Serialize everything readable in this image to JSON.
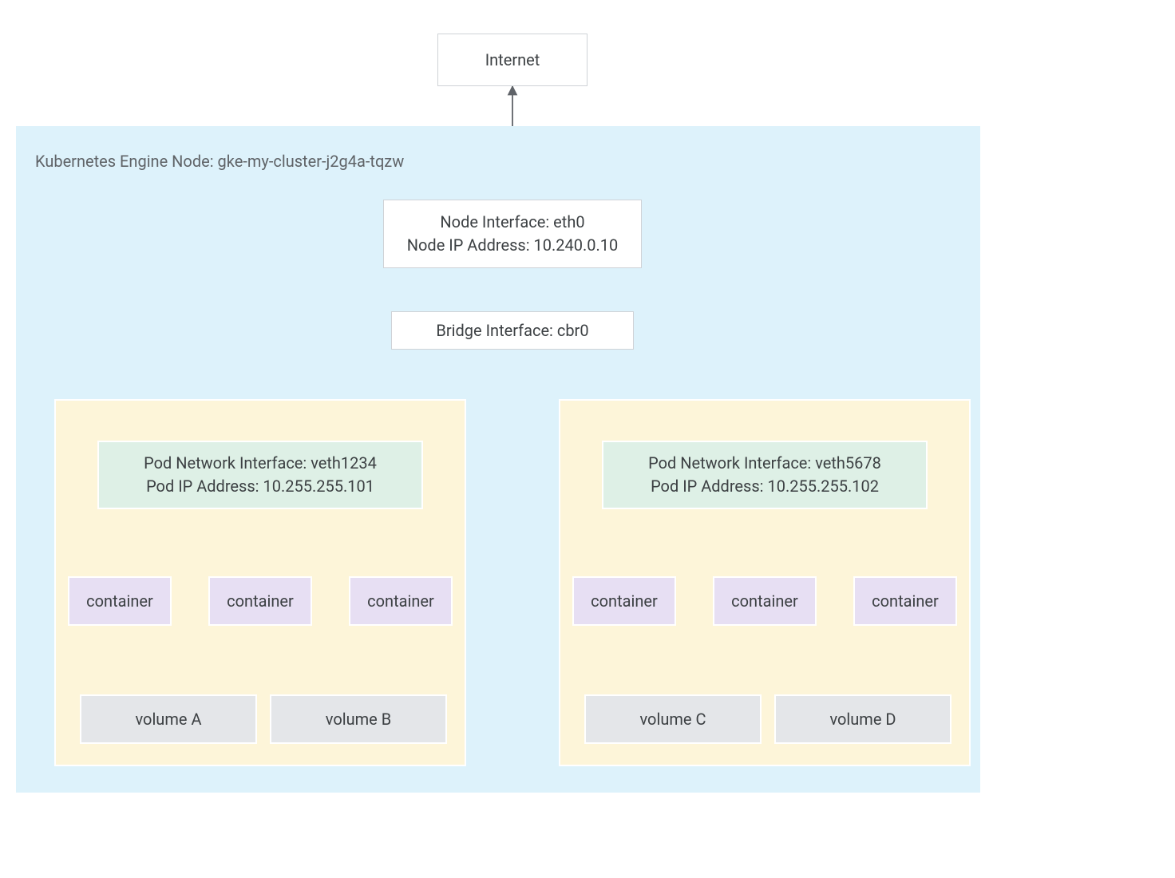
{
  "internet": "Internet",
  "node": {
    "title": "Kubernetes Engine Node: gke-my-cluster-j2g4a-tqzw",
    "iface_line1": "Node Interface: eth0",
    "iface_line2": "Node IP Address: 10.240.0.10"
  },
  "bridge": "Bridge Interface: cbr0",
  "pods": [
    {
      "iface_line1": "Pod Network Interface: veth1234",
      "iface_line2": "Pod IP Address: 10.255.255.101",
      "containers": [
        "container",
        "container",
        "container"
      ],
      "volumes": [
        "volume A",
        "volume B"
      ]
    },
    {
      "iface_line1": "Pod Network Interface: veth5678",
      "iface_line2": "Pod IP Address: 10.255.255.102",
      "containers": [
        "container",
        "container",
        "container"
      ],
      "volumes": [
        "volume C",
        "volume D"
      ]
    }
  ]
}
